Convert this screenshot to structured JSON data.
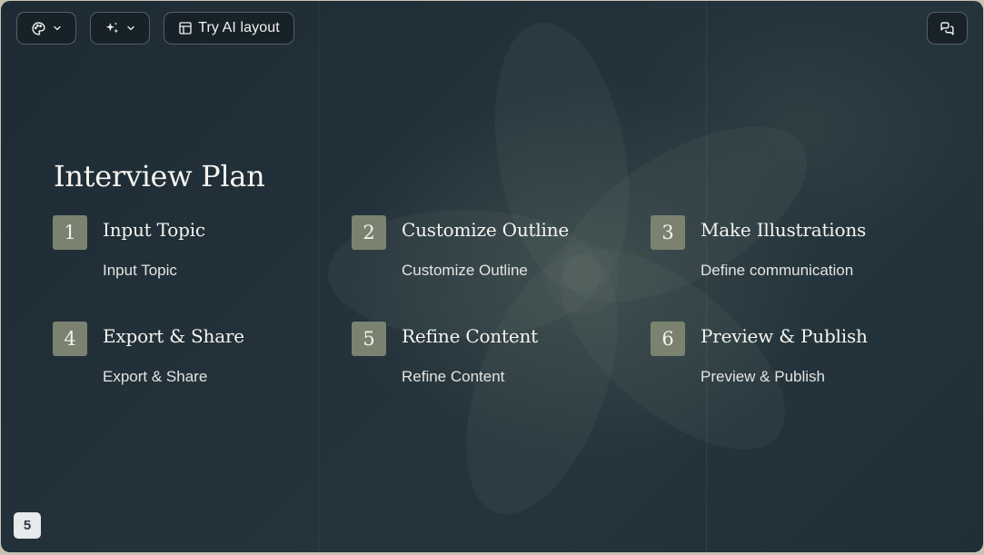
{
  "toolbar": {
    "theme_icon": "palette-icon",
    "ai_icon": "sparkles-icon",
    "dropdown_icon": "chevron-down-icon",
    "ai_layout_icon": "layout-icon",
    "ai_layout_label": "Try AI layout",
    "comments_icon": "comments-icon"
  },
  "slide": {
    "title": "Interview Plan",
    "steps": [
      {
        "number": "1",
        "title": "Input Topic",
        "description": "Input Topic"
      },
      {
        "number": "2",
        "title": "Customize Outline",
        "description": "Customize Outline"
      },
      {
        "number": "3",
        "title": "Make Illustrations",
        "description": "Define communication"
      },
      {
        "number": "4",
        "title": "Export & Share",
        "description": "Export & Share"
      },
      {
        "number": "5",
        "title": "Refine Content",
        "description": "Refine Content"
      },
      {
        "number": "6",
        "title": "Preview & Publish",
        "description": "Preview & Publish"
      }
    ]
  },
  "page": {
    "number": "5"
  },
  "colors": {
    "background": "#1f2e37",
    "number_badge": "#7b8270",
    "text": "#f4f3ef",
    "page_badge": "#e8e9eb"
  }
}
